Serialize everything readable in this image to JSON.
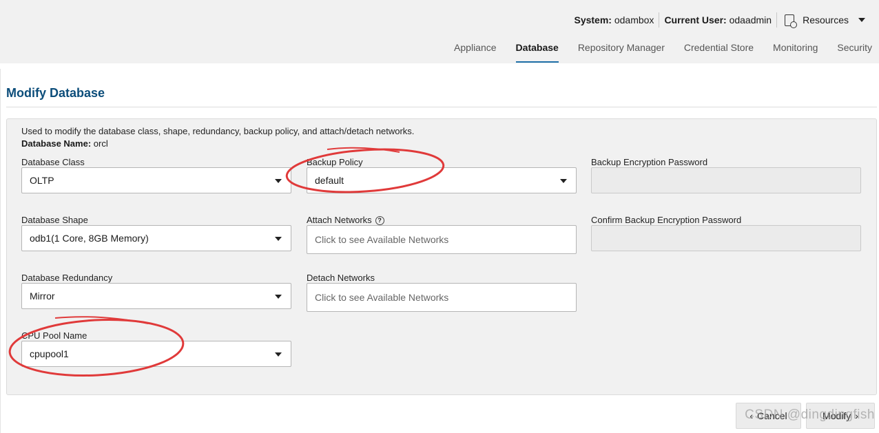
{
  "header": {
    "system_label": "System:",
    "system_value": "odambox",
    "user_label": "Current User:",
    "user_value": "odaadmin",
    "resources_label": "Resources"
  },
  "tabs": [
    {
      "label": "Appliance",
      "active": false
    },
    {
      "label": "Database",
      "active": true
    },
    {
      "label": "Repository Manager",
      "active": false
    },
    {
      "label": "Credential Store",
      "active": false
    },
    {
      "label": "Monitoring",
      "active": false
    },
    {
      "label": "Security",
      "active": false
    }
  ],
  "page": {
    "title": "Modify Database",
    "description": "Used to modify the database class, shape, redundancy, backup policy, and attach/detach networks.",
    "db_name_label": "Database Name:",
    "db_name_value": "orcl"
  },
  "form": {
    "database_class": {
      "label": "Database Class",
      "value": "OLTP"
    },
    "database_shape": {
      "label": "Database Shape",
      "value": "odb1(1 Core, 8GB Memory)"
    },
    "database_redundancy": {
      "label": "Database Redundancy",
      "value": "Mirror"
    },
    "cpu_pool_name": {
      "label": "CPU Pool Name",
      "value": "cpupool1"
    },
    "backup_policy": {
      "label": "Backup Policy",
      "value": "default"
    },
    "attach_networks": {
      "label": "Attach Networks",
      "placeholder": "Click to see Available Networks"
    },
    "detach_networks": {
      "label": "Detach Networks",
      "placeholder": "Click to see Available Networks"
    },
    "backup_encryption_password": {
      "label": "Backup Encryption Password",
      "value": ""
    },
    "confirm_backup_encryption_password": {
      "label": "Confirm Backup Encryption Password",
      "value": ""
    }
  },
  "buttons": {
    "cancel_label": "Cancel",
    "modify_label": "Modify"
  },
  "watermark": "CSDN @dingdingfish",
  "colors": {
    "title": "#0c4d7a",
    "active_tab_underline": "#1e6fa8",
    "annotation_ellipse": "#e03a3a"
  }
}
